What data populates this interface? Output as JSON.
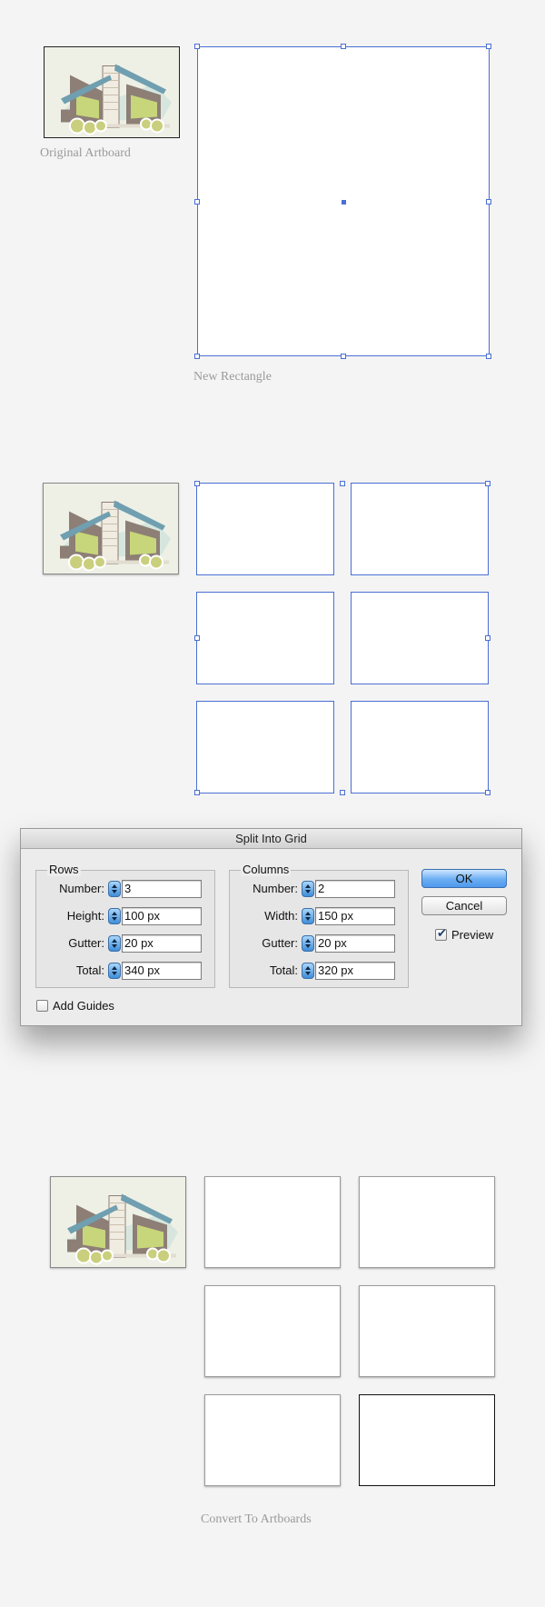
{
  "captions": {
    "original_artboard": "Original Artboard",
    "new_rectangle": "New Rectangle",
    "convert_to_artboards": "Convert To Artboards"
  },
  "dialog": {
    "title": "Split Into Grid",
    "rows": {
      "legend": "Rows",
      "number_label": "Number:",
      "number_value": "3",
      "height_label": "Height:",
      "height_value": "100 px",
      "gutter_label": "Gutter:",
      "gutter_value": "20 px",
      "total_label": "Total:",
      "total_value": "340 px"
    },
    "columns": {
      "legend": "Columns",
      "number_label": "Number:",
      "number_value": "2",
      "width_label": "Width:",
      "width_value": "150 px",
      "gutter_label": "Gutter:",
      "gutter_value": "20 px",
      "total_label": "Total:",
      "total_value": "320 px"
    },
    "ok_label": "OK",
    "cancel_label": "Cancel",
    "preview_label": "Preview",
    "preview_checked": true,
    "add_guides_label": "Add Guides",
    "add_guides_checked": false
  },
  "colors": {
    "selection": "#4a6fd4",
    "background": "#f4f4f4"
  }
}
